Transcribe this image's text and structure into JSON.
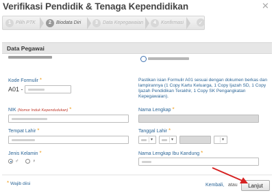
{
  "window": {
    "title": "Verifikasi Pendidik & Tenaga Kependidikan"
  },
  "wizard": {
    "steps": [
      {
        "num": "1",
        "label": "Pilih PTK"
      },
      {
        "num": "2",
        "label": "Biodata Diri"
      },
      {
        "num": "3",
        "label": "Data Kepegawaian"
      },
      {
        "num": "4",
        "label": "Konfirmasi"
      }
    ],
    "active_step": 2
  },
  "section": {
    "title": "Data Pegawai"
  },
  "form": {
    "kode_formulir": {
      "label": "Kode Formulir",
      "prefix": "A01 -"
    },
    "info": "Pastikan isian Formulir A01 sesuai dengan dokumen berkas dan lampirannya (1 Copy Kartu Keluarga, 1 Copy Ijazah SD, 1 Copy Ijazah Pendidikan Terakhir, 1 Copy SK Pengangkatan Kepegawaian).",
    "nik": {
      "label": "NIK",
      "sub": "(Nomor Induk Kependudukan)"
    },
    "nama_lengkap": {
      "label": "Nama Lengkap"
    },
    "tempat_lahir": {
      "label": "Tempat Lahir"
    },
    "tanggal_lahir": {
      "label": "Tanggal Lahir"
    },
    "jenis_kelamin": {
      "label": "Jenis Kelamin",
      "options": [
        "♂",
        "♀"
      ]
    },
    "nama_ibu": {
      "label": "Nama Lengkap Ibu Kandung"
    },
    "required_mark": "*"
  },
  "footer": {
    "required_note": "Wajib diisi",
    "back_link": "Kembali,",
    "or_text": "atau",
    "next_button": "Lanjut"
  },
  "colors": {
    "accent": "#2a6496",
    "required": "#f0a020",
    "annotation_arrow": "#d62222"
  }
}
